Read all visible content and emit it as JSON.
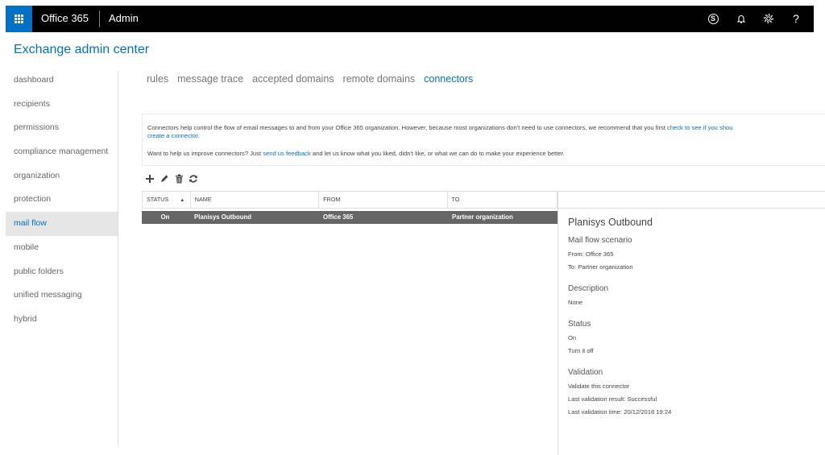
{
  "topbar": {
    "app_title": "Office 365",
    "app_sub": "Admin",
    "icons": [
      "skype-icon",
      "bell-icon",
      "gear-icon",
      "help-icon"
    ],
    "skype_glyph": "S",
    "help_glyph": "?"
  },
  "header": {
    "title": "Exchange admin center"
  },
  "sidebar": {
    "items": [
      {
        "label": "dashboard"
      },
      {
        "label": "recipients"
      },
      {
        "label": "permissions"
      },
      {
        "label": "compliance management"
      },
      {
        "label": "organization"
      },
      {
        "label": "protection"
      },
      {
        "label": "mail flow",
        "active": true
      },
      {
        "label": "mobile"
      },
      {
        "label": "public folders"
      },
      {
        "label": "unified messaging"
      },
      {
        "label": "hybrid"
      }
    ]
  },
  "tabs": [
    {
      "label": "rules"
    },
    {
      "label": "message trace"
    },
    {
      "label": "accepted domains"
    },
    {
      "label": "remote domains"
    },
    {
      "label": "connectors",
      "active": true
    }
  ],
  "info": {
    "line1_text": "Connectors help control the flow of email messages to and from your Office 365 organization. However, because most organizations don't need to use connectors, we recommend that you first ",
    "line1_link": "check to see if you shou",
    "line2_link": "create a connector.",
    "line3_pre": "Want to help us improve connectors? Just ",
    "line3_link": "send us feedback",
    "line3_post": " and let us know what you liked, didn't like, or what we can do to make your experience better."
  },
  "toolbar": {
    "add_glyph": "+",
    "actions": [
      "add-icon",
      "edit-icon",
      "delete-icon",
      "refresh-icon"
    ]
  },
  "table": {
    "columns": [
      "STATUS",
      "NAME",
      "FROM",
      "TO"
    ],
    "sort_arrow": "▲",
    "rows": [
      {
        "status": "On",
        "name": "Planisys Outbound",
        "from": "Office 365",
        "to": "Partner organization",
        "selected": true
      }
    ]
  },
  "details": {
    "title": "Planisys Outbound",
    "scenario_heading": "Mail flow scenario",
    "from": "From: Office 365",
    "to": "To: Partner organization",
    "description_heading": "Description",
    "description": "None",
    "status_heading": "Status",
    "status": "On",
    "turn_off_link": "Turn it off",
    "validation_heading": "Validation",
    "validate_link": "Validate this connector",
    "last_result": "Last validation result: Successful",
    "last_time": "Last validation time: 20/12/2018 19:24"
  },
  "colors": {
    "accent": "#0072c6",
    "topbar": "#000000",
    "selected_row": "#666666",
    "active_nav_bg": "#e6e6e6"
  }
}
